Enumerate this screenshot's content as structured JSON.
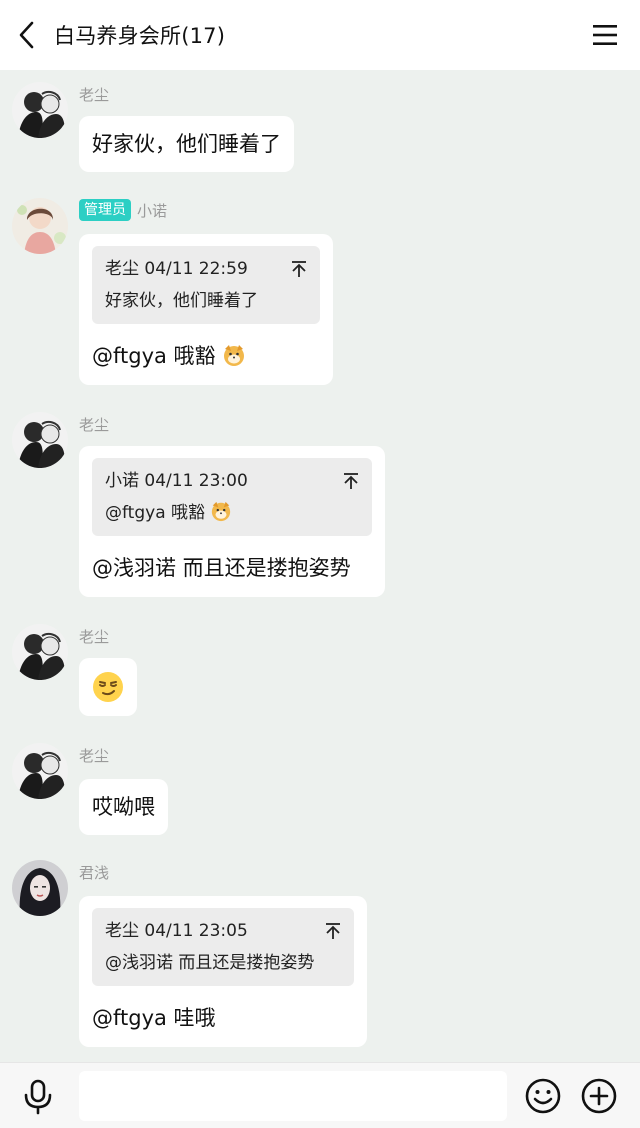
{
  "header": {
    "title": "白马养身会所(17)",
    "back_icon": "chevron-left-icon",
    "menu_icon": "hamburger-menu-icon"
  },
  "messages": [
    {
      "sender": "老尘",
      "text": "好家伙，他们睡着了"
    },
    {
      "sender": "小诺",
      "role": "管理员",
      "quote": {
        "head": "老尘 04/11 22:59",
        "body": "好家伙，他们睡着了"
      },
      "text": "@ftgya 哦豁"
    },
    {
      "sender": "老尘",
      "quote": {
        "head": "小诺 04/11 23:00",
        "body": "@ftgya 哦豁"
      },
      "text": "@浅羽诺 而且还是搂抱姿势"
    },
    {
      "sender": "老尘",
      "emoji": "smirk-face-emoji"
    },
    {
      "sender": "老尘",
      "text": "哎呦喂"
    },
    {
      "sender": "君浅",
      "quote": {
        "head": "老尘 04/11 23:05",
        "body": "@浅羽诺 而且还是搂抱姿势"
      },
      "text": "@ftgya 哇哦"
    }
  ],
  "bottom_bar": {
    "voice_icon": "microphone-icon",
    "input_value": "",
    "emoji_icon": "smiley-icon",
    "plus_icon": "plus-circle-icon"
  },
  "colors": {
    "chat_background": "#edf1ee",
    "bubble": "#ffffff",
    "quote_background": "#ececec",
    "admin_badge": "#2ccfc4",
    "sender_name": "#9a9a9a"
  }
}
